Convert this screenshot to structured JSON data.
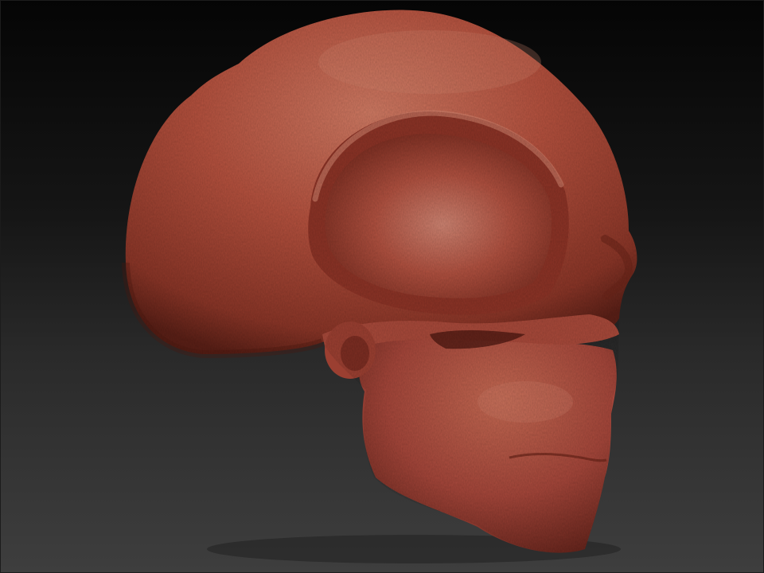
{
  "viewport": {
    "background_top": "#050505",
    "background_bottom": "#3e3e3e"
  },
  "model": {
    "kind": "skull-sculpt",
    "material_color": "#b5513e",
    "highlight_color": "#d98a75",
    "shadow_color": "#5a1f16",
    "orientation": "side-view-facing-right"
  }
}
